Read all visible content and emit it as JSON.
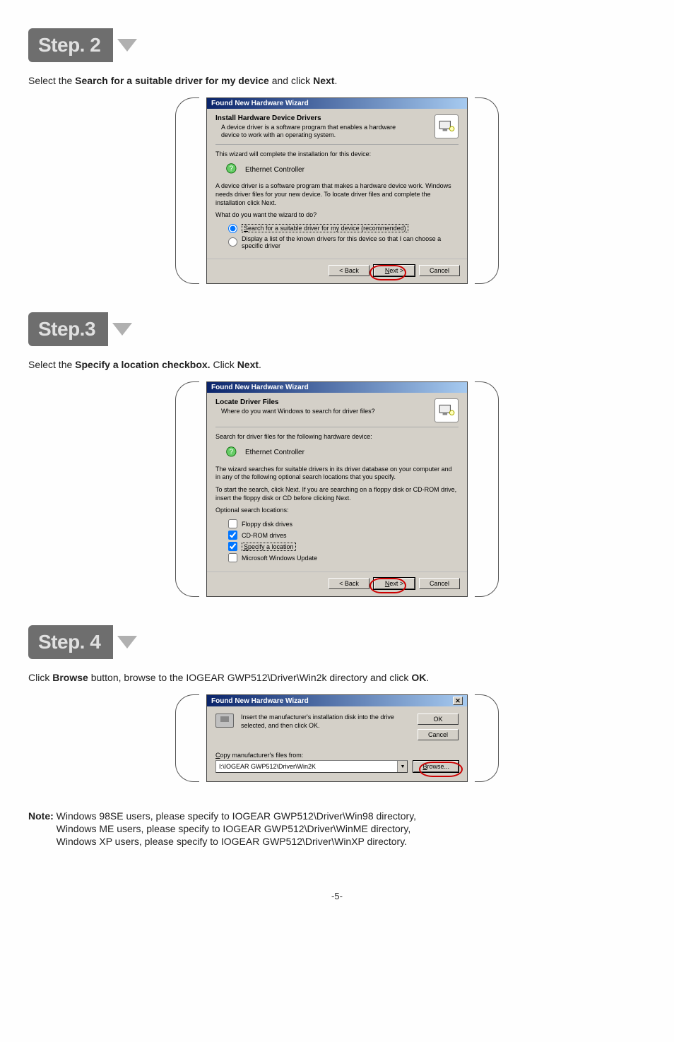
{
  "steps": {
    "s2": {
      "label": "Step. 2"
    },
    "s3": {
      "label": "Step.3"
    },
    "s4": {
      "label": "Step. 4"
    }
  },
  "instr2": {
    "pre": "Select the ",
    "bold": "Search for a suitable driver for my device",
    "mid": " and click ",
    "bold2": "Next",
    "post": "."
  },
  "instr3": {
    "pre": "Select the ",
    "bold": "Specify a location checkbox.",
    "mid": " Click ",
    "bold2": "Next",
    "post": "."
  },
  "instr4": {
    "pre": "Click ",
    "bold": "Browse",
    "mid": " button, browse to the IOGEAR GWP512\\Driver\\Win2k directory and click ",
    "bold2": "OK",
    "post": "."
  },
  "dlg": {
    "title": "Found New Hardware Wizard",
    "header1": {
      "h1": "Install Hardware Device Drivers",
      "h2": "A device driver is a software program that enables a hardware device to work with an operating system."
    },
    "p1": "This wizard will complete the installation for this device:",
    "device": "Ethernet Controller",
    "p2": "A device driver is a software program that makes a hardware device work. Windows needs driver files for your new device. To locate driver files and complete the installation click Next.",
    "p3": "What do you want the wizard to do?",
    "r1": "Search for a suitable driver for my device (recommended)",
    "r2": "Display a list of the known drivers for this device so that I can choose a specific driver",
    "back": "< Back",
    "next": "Next >",
    "cancel": "Cancel"
  },
  "dlg3": {
    "h1": "Locate Driver Files",
    "h2": "Where do you want Windows to search for driver files?",
    "p1": "Search for driver files for the following hardware device:",
    "device": "Ethernet Controller",
    "p2": "The wizard searches for suitable drivers in its driver database on your computer and in any of the following optional search locations that you specify.",
    "p3": "To start the search, click Next. If you are searching on a floppy disk or CD-ROM drive, insert the floppy disk or CD before clicking Next.",
    "opt_label": "Optional search locations:",
    "c1": "Floppy disk drives",
    "c2": "CD-ROM drives",
    "c3": "Specify a location",
    "c4": "Microsoft Windows Update"
  },
  "dlg4": {
    "msg": "Insert the manufacturer's installation disk into the drive selected, and then click OK.",
    "ok": "OK",
    "cancel": "Cancel",
    "copy_label": "Copy manufacturer's files from:",
    "path": "I:\\IOGEAR GWP512\\Driver\\Win2K",
    "browse": "Browse..."
  },
  "note": {
    "label": "Note: ",
    "l1": "Windows 98SE users, please specify to IOGEAR GWP512\\Driver\\Win98 directory,",
    "l2": "Windows ME users, please specify to IOGEAR GWP512\\Driver\\WinME directory,",
    "l3": "Windows XP users, please specify to IOGEAR GWP512\\Driver\\WinXP directory."
  },
  "page": "-5-"
}
